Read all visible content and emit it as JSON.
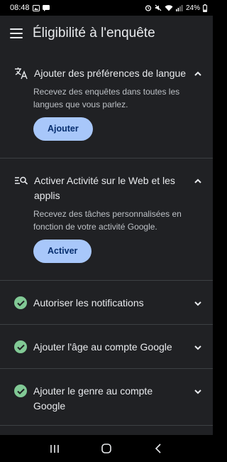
{
  "status_bar": {
    "time": "08:48",
    "battery": "24%"
  },
  "app_bar": {
    "title": "Éligibilité à l'enquête"
  },
  "cards": [
    {
      "title": "Ajouter des préférences de langue",
      "description": "Recevez des enquêtes dans toutes les langues que vous parlez.",
      "button_label": "Ajouter",
      "icon": "translate-icon",
      "state": "expanded"
    },
    {
      "title": "Activer Activité sur le Web et les applis",
      "description": "Recevez des tâches personnalisées en fonction de votre activité Google.",
      "button_label": "Activer",
      "icon": "manage-search-icon",
      "state": "expanded"
    },
    {
      "title": "Autoriser les notifications",
      "icon": "check-circle-icon",
      "state": "completed"
    },
    {
      "title": "Ajouter l'âge au compte Google",
      "icon": "check-circle-icon",
      "state": "completed"
    },
    {
      "title": "Ajouter le genre au compte Google",
      "icon": "check-circle-icon",
      "state": "completed"
    }
  ],
  "colors": {
    "background": "#202124",
    "button_fill": "#a8c7fa",
    "button_text": "#062e6f",
    "check_green": "#81c995",
    "divider": "#3c4043"
  }
}
